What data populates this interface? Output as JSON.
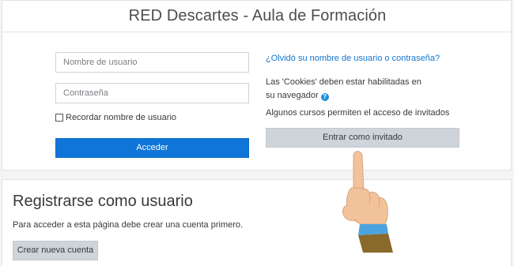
{
  "header": {
    "site_title": "RED Descartes - Aula de Formación"
  },
  "login": {
    "username_placeholder": "Nombre de usuario",
    "password_placeholder": "Contraseña",
    "remember_label": "Recordar nombre de usuario",
    "login_button": "Acceder",
    "forgot_link": "¿Olvidó su nombre de usuario o contraseña?",
    "cookies_text": "Las 'Cookies' deben estar habilitadas en su navegador",
    "help_icon": "question-circle-icon",
    "guest_note": "Algunos cursos permiten el acceso de invitados",
    "guest_button": "Entrar como invitado"
  },
  "register": {
    "title": "Registrarse como usuario",
    "text": "Para acceder a esta página debe crear una cuenta primero.",
    "create_button": "Crear nueva cuenta"
  },
  "colors": {
    "primary": "#0f75d8",
    "link": "#1177d1",
    "secondary_button": "#ced4da",
    "background": "#f4f4f4"
  }
}
